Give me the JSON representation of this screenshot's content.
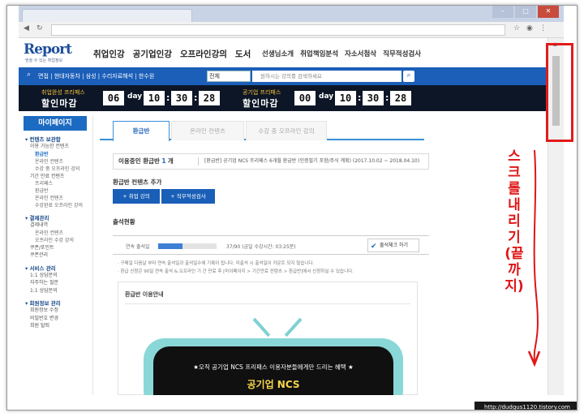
{
  "site": {
    "logo": "Report",
    "logo_tagline": "믿을 수 있는 취업정보"
  },
  "gnb": [
    "취업인강",
    "공기업인강",
    "오프라인강의",
    "도서"
  ],
  "gnb_secondary": [
    "선생님소개",
    "취업책임분석",
    "자소서첨삭",
    "직무적성검사"
  ],
  "searchbar": {
    "links": "면접 | 현대자동차 | 삼성 | 수리자료해석 | 한수원",
    "select": "전체",
    "placeholder": "원하시는 강의를 검색하세요"
  },
  "promo": {
    "left_tag": "취업완성 프리패스",
    "left_main": "할인마감",
    "right_tag": "공기업 프리패스",
    "right_main": "할인마감",
    "left_days": "06",
    "right_days": "00",
    "day_label": "day",
    "left_time": [
      "10",
      "30",
      "28"
    ],
    "right_time": [
      "10",
      "30",
      "28"
    ]
  },
  "sidebar": {
    "title": "마이페이지",
    "sections": [
      {
        "title": "컨텐츠 보관함",
        "items": [
          {
            "label": "이용 가능한 컨텐츠",
            "subs": [
              "환급반",
              "온라인 컨텐츠",
              "수강 중 오프라인 강의"
            ]
          },
          {
            "label": "기간 만료 컨텐츠",
            "subs": [
              "프리패스",
              "환급반",
              "온라인 컨텐츠",
              "수강완료 오프라인 강의"
            ]
          }
        ]
      },
      {
        "title": "결제관리",
        "items": [
          {
            "label": "결제내역",
            "subs": [
              "온라인 컨텐츠",
              "오프라인 수강 강의"
            ]
          },
          {
            "label": "쿠폰/포인트",
            "subs": []
          },
          {
            "label": "쿠폰관리",
            "subs": []
          }
        ]
      },
      {
        "title": "서비스 관리",
        "items": [
          {
            "label": "1:1 상담문의",
            "subs": []
          },
          {
            "label": "자주하는 질문",
            "subs": []
          },
          {
            "label": "1:1 상담문의",
            "subs": []
          }
        ]
      },
      {
        "title": "회원정보 관리",
        "items": [
          {
            "label": "회원정보 수정",
            "subs": []
          },
          {
            "label": "비밀번호 변경",
            "subs": []
          },
          {
            "label": "회원 탈퇴",
            "subs": []
          }
        ]
      }
    ]
  },
  "tabs": [
    "환급반",
    "온라인 컨텐츠",
    "수강 중 오프라인 강의"
  ],
  "using": {
    "label_pre": "이용중인 환급반",
    "count": "1",
    "label_post": "개",
    "detail": "[환급반] 공기업 NCS 프리패스 6개월 환급반 (인증필기 포함/주식 계획) (2017.10.02 ~ 2018.04.10)"
  },
  "add_contents_label": "환급반 컨텐츠 추가",
  "add_buttons": [
    "+ 취업 강의",
    "+ 직무적성검사"
  ],
  "attendance": {
    "title": "출석현황",
    "rate_label": "연속 출석일",
    "rate_fraction": 0.41,
    "value_text": "37/90 (금일 수강시간: 03:25분)",
    "check_button": "출석체크 하기",
    "check_icon": "check-icon"
  },
  "notes": [
    "· 구매일 다음날 부터 연속 출석일과 출석일수에 기록이 됩니다. 미출석 시 출석일이 카운트 되지 않습니다.",
    "· 환급 신청은 90일 연속 출석 & 오프라인 기 간 만료 후 [마이페이지 > 기간만료 컨텐츠 > 환급반]에서 신청하실 수 있습니다."
  ],
  "guide": {
    "title": "환급반 이용안내",
    "line": "★오직 공기업 NCS 프리패스 이용자분들에게만 드리는 혜택 ★",
    "headline": "공기업 NCS"
  },
  "annotation": "스크롤 내리기(끝까지)",
  "watermark": "http://dudgus1120.tistory.com",
  "colors": {
    "brand_blue": "#1b5fb9",
    "annotation_red": "#e01515",
    "tv_teal": "#8ad7d8"
  }
}
